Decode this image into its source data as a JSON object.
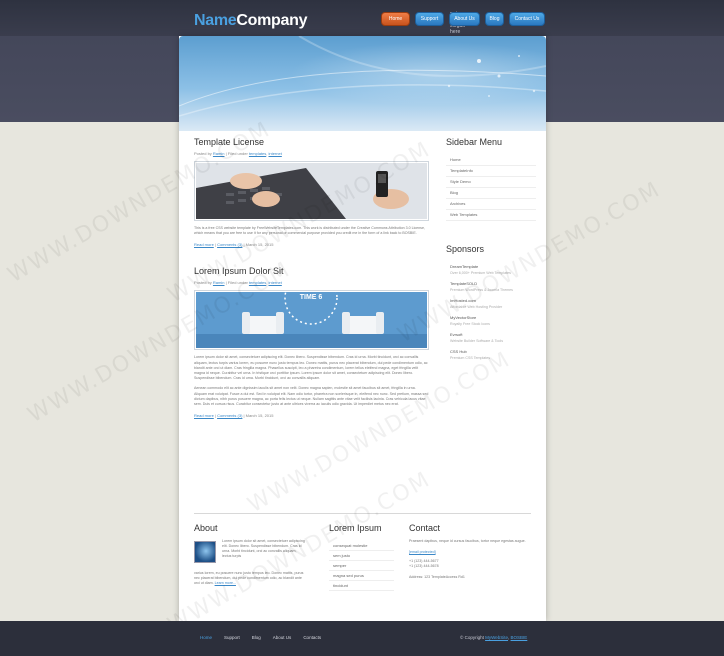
{
  "logo": {
    "name_part1": "Name",
    "name_part2": "Company",
    "slogan": "put your slogan here"
  },
  "topnav": [
    {
      "label": "Home",
      "active": true
    },
    {
      "label": "Support",
      "active": false
    },
    {
      "label": "About Us",
      "active": false
    },
    {
      "label": "Blog",
      "active": false
    },
    {
      "label": "Contact Us",
      "active": false
    }
  ],
  "posts": [
    {
      "title": "Template License",
      "meta_prefix": "Posted by",
      "author": "Ramin",
      "meta_filed": "| Filed under",
      "category1": "templates",
      "category2": "internet",
      "text": "This is a free CSS website template by FreeWebsiteTemplates.com. This work is distributed under the Creative Commons Attribution 3.0 License, which means that you are free to use it for any personal or commercial purpose provided you credit me in the form of a link back to BOSBIE.",
      "read_more": "Read more",
      "comments": "Comments (3)",
      "date": "March 15, 2015"
    },
    {
      "title": "Lorem Ipsum Dolor Sit",
      "meta_prefix": "Posted by",
      "author": "Ramin",
      "meta_filed": "| Filed under",
      "category1": "templates",
      "category2": "internet",
      "image_caption": "TIME 6",
      "text": "Lorem ipsum dolor sit amet, consectetuer adipiscing elit. Donec libero. Suspendisse bibendum. Cras id urna. Morbi tincidunt, orci ac convallis aliquam, lectus turpis varius lorem, eu posuere nunc justo tempus leo. Donec mattis, purus nec placerat bibendum, dui pede condimentum odio, ac blandit ante orci ut diam. Cras fringilla magna. Phasellus suscipit, leo a pharetra condimentum, lorem tellus eleifend magna, eget fringilla velit magna id neque. Curabitur vel urna. In tristique orci porttitor ipsum. Lorem ipsum dolor sit amet, consectetuer adipiscing elit. Donec libero. Suspendisse bibendum. Cras id urna. Morbi tincidunt, orci ac convallis aliquam.",
      "text2": "Aenean commodo elit ac ante dignissim iaculis sit amet non velit. Donec magna sapien, molestie sit amet faucibus sit amet, fringilla in urna. Aliquam erat volutpat. Fusce a dui est. Sed in volutpat elit. Nam odio tortor, pharetra non scelerisque in, eleifend nec nunc. Sed pretium, massa sed dictum dapibus, nibh purus posuere magna, ac porta felis lectus ut neque. Nullam sagittis ante vitae velit facilisis lacinia. Cras vehicula lacus vitae sem. Duis et cursus risus. Curabitur consectetur justo at ante ultrices viverra ac iaculis odio gravida. Ut imperdiet metus nec erat.",
      "read_more": "Read more",
      "comments": "Comments (3)",
      "date": "March 15, 2015"
    }
  ],
  "sidebar": {
    "menu_title": "Sidebar Menu",
    "menu": [
      "Home",
      "TemplateInfo",
      "Style Demo",
      "Blog",
      "Archives",
      "Web Templates"
    ],
    "sponsors_title": "Sponsors",
    "sponsors": [
      {
        "name": "DreamTemplate",
        "desc": "Over 6,000+ Premium Web Templates"
      },
      {
        "name": "TemplateSOLD",
        "desc": "Premium WordPress & Joomla Themes"
      },
      {
        "name": "ImHosted.com",
        "desc": "Affordable Web Hosting Provider"
      },
      {
        "name": "MyVectorStore",
        "desc": "Royalty Free Stock Icons"
      },
      {
        "name": "Evrsoft",
        "desc": "Website Builder Software & Tools"
      },
      {
        "name": "CSS Hub",
        "desc": "Premium CSS Templates"
      }
    ]
  },
  "footer_cols": {
    "about_title": "About",
    "about_text": "Lorem ipsum dolor sit amet, consectetuer adipiscing elit. Donec libero. Suspendisse bibendum. Cras id urna. Morbi tincidunt, orci ac convallis aliquam, lectus turpis",
    "about_text2": "varius lorem, eu posuere nunc justo tempus leo. Donec mattis, purus nec placerat bibendum, dui pede condimentum odio, ac blandit ante orci ut diam.",
    "about_read_more": "Learn more...",
    "lorem_title": "Lorem Ipsum",
    "lorem_list": [
      "consequat molestie",
      "sem justo",
      "semper",
      "magna sed purus",
      "tincidunt"
    ],
    "contact_title": "Contact",
    "contact_text": "Praesent dapibus, neque id cursus faucibus, tortor neque egestas augue.",
    "contact_email": "[email protected]",
    "contact_phone1": "+1 (123) 444-5677",
    "contact_phone2": "+1 (123) 444-5678",
    "contact_address": "Address: 123 TemplateAccess Rd1"
  },
  "footer": {
    "nav": [
      "Home",
      "Support",
      "Blog",
      "About Us",
      "Contacts"
    ],
    "copyright_prefix": "© Copyright",
    "copyright_link1": "MyWebSite",
    "copyright_link2": "BOSBIE"
  }
}
